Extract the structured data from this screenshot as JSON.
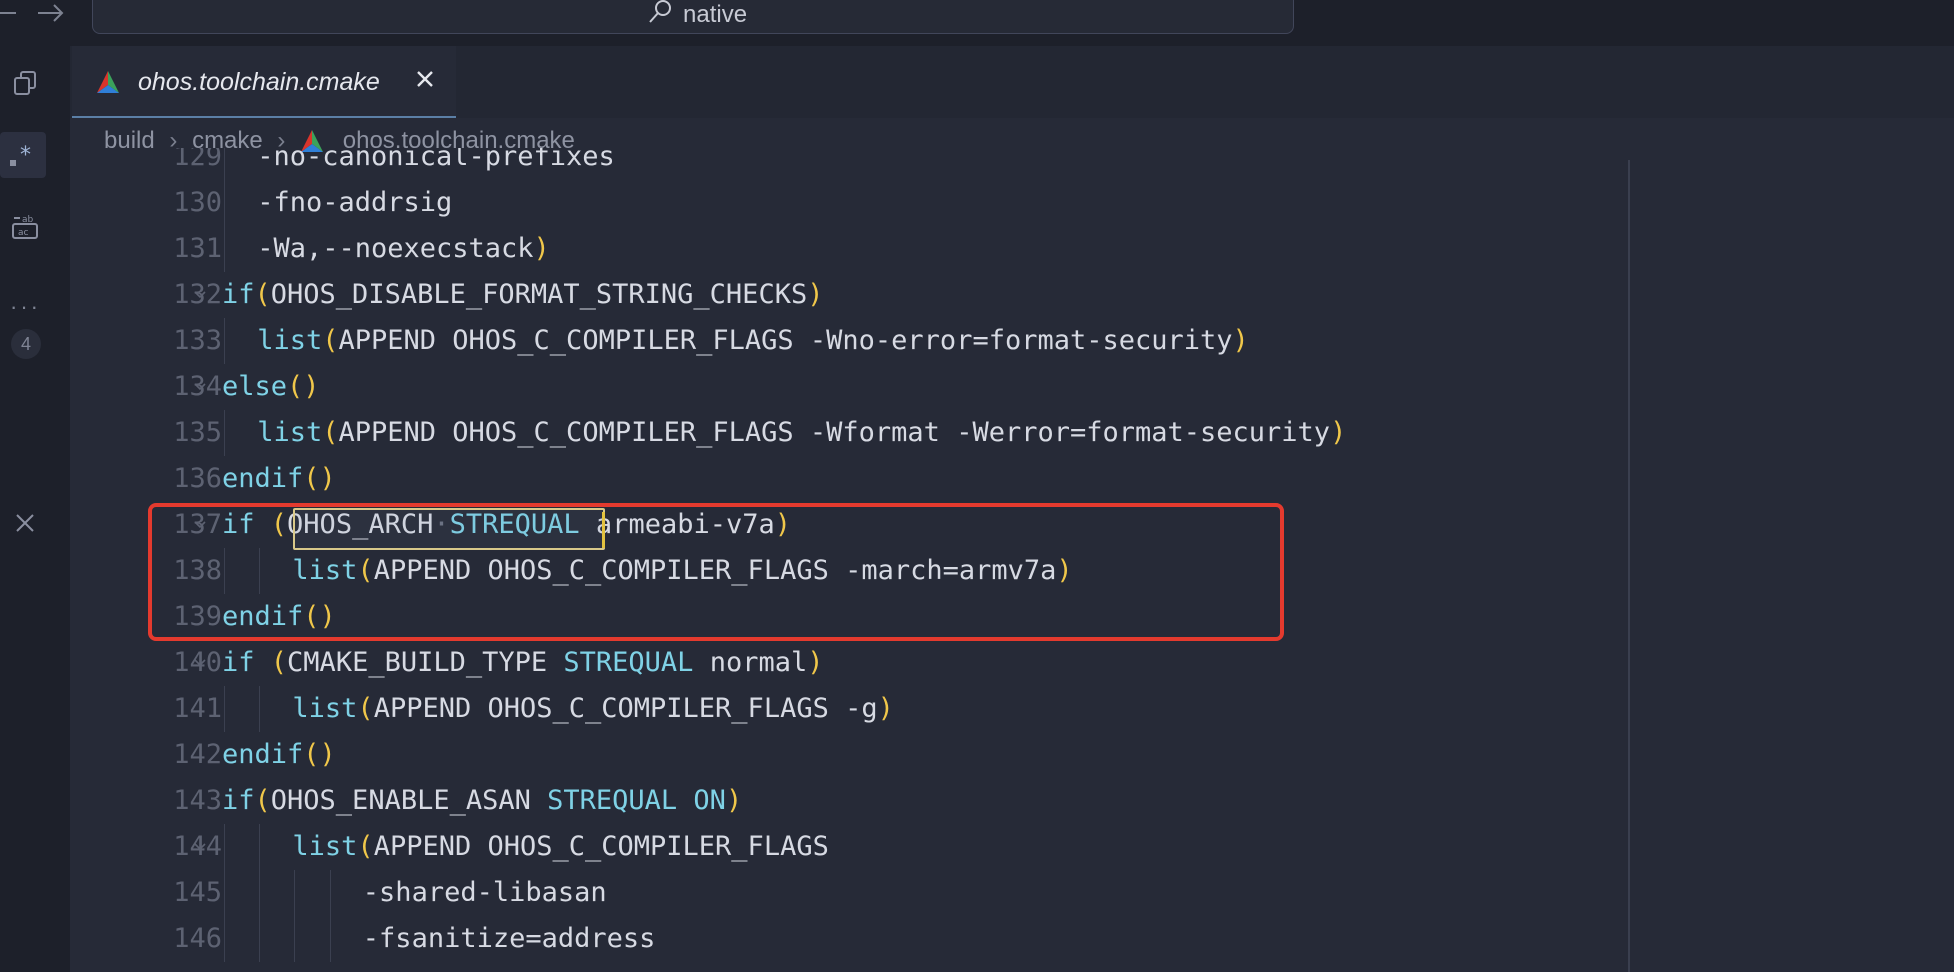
{
  "search": {
    "text": "native"
  },
  "activity": {
    "badge": "4"
  },
  "tab": {
    "label": "ohos.toolchain.cmake"
  },
  "breadcrumbs": [
    "build",
    "cmake",
    "ohos.toolchain.cmake"
  ],
  "code": {
    "lines": [
      {
        "n": "129",
        "indent": 1,
        "fold": false,
        "tokens": [
          {
            "t": "-no-canonical-prefixes",
            "c": "plain"
          }
        ]
      },
      {
        "n": "130",
        "indent": 1,
        "fold": false,
        "tokens": [
          {
            "t": "-fno-addrsig",
            "c": "plain"
          }
        ]
      },
      {
        "n": "131",
        "indent": 1,
        "fold": false,
        "tokens": [
          {
            "t": "-Wa,--noexecstack",
            "c": "plain"
          },
          {
            "t": ")",
            "c": "paren"
          }
        ]
      },
      {
        "n": "132",
        "indent": 0,
        "fold": true,
        "tokens": [
          {
            "t": "if",
            "c": "kw"
          },
          {
            "t": "(",
            "c": "paren"
          },
          {
            "t": "OHOS_DISABLE_FORMAT_STRING_CHECKS",
            "c": "plain"
          },
          {
            "t": ")",
            "c": "paren"
          }
        ]
      },
      {
        "n": "133",
        "indent": 1,
        "fold": false,
        "tokens": [
          {
            "t": "list",
            "c": "kw"
          },
          {
            "t": "(",
            "c": "paren"
          },
          {
            "t": "APPEND OHOS_C_COMPILER_FLAGS -Wno-error=format-security",
            "c": "plain"
          },
          {
            "t": ")",
            "c": "paren"
          }
        ]
      },
      {
        "n": "134",
        "indent": 0,
        "fold": true,
        "tokens": [
          {
            "t": "else",
            "c": "kw"
          },
          {
            "t": "()",
            "c": "paren"
          }
        ]
      },
      {
        "n": "135",
        "indent": 1,
        "fold": false,
        "tokens": [
          {
            "t": "list",
            "c": "kw"
          },
          {
            "t": "(",
            "c": "paren"
          },
          {
            "t": "APPEND OHOS_C_COMPILER_FLAGS -Wformat -Werror=format-security",
            "c": "plain"
          },
          {
            "t": ")",
            "c": "paren"
          }
        ]
      },
      {
        "n": "136",
        "indent": 0,
        "fold": false,
        "tokens": [
          {
            "t": "endif",
            "c": "kw"
          },
          {
            "t": "()",
            "c": "paren"
          }
        ]
      },
      {
        "n": "137",
        "indent": 0,
        "fold": true,
        "tokens": [
          {
            "t": "if",
            "c": "kw"
          },
          {
            "t": " ",
            "c": "plain"
          },
          {
            "t": "(",
            "c": "paren"
          },
          {
            "t": "OHOS_ARCH",
            "c": "plain"
          },
          {
            "t": "·",
            "c": "dot"
          },
          {
            "t": "STREQUAL",
            "c": "kw"
          },
          {
            "t": " armeabi-v7a",
            "c": "plain"
          },
          {
            "t": ")",
            "c": "paren"
          }
        ]
      },
      {
        "n": "138",
        "indent": 2,
        "fold": false,
        "tokens": [
          {
            "t": "list",
            "c": "kw"
          },
          {
            "t": "(",
            "c": "paren"
          },
          {
            "t": "APPEND OHOS_C_COMPILER_FLAGS -march=armv7a",
            "c": "plain"
          },
          {
            "t": ")",
            "c": "paren"
          }
        ]
      },
      {
        "n": "139",
        "indent": 0,
        "fold": false,
        "tokens": [
          {
            "t": "endif",
            "c": "kw"
          },
          {
            "t": "()",
            "c": "paren"
          }
        ]
      },
      {
        "n": "140",
        "indent": 0,
        "fold": true,
        "tokens": [
          {
            "t": "if",
            "c": "kw"
          },
          {
            "t": " ",
            "c": "plain"
          },
          {
            "t": "(",
            "c": "paren"
          },
          {
            "t": "CMAKE_BUILD_TYPE ",
            "c": "plain"
          },
          {
            "t": "STREQUAL",
            "c": "kw"
          },
          {
            "t": " normal",
            "c": "plain"
          },
          {
            "t": ")",
            "c": "paren"
          }
        ]
      },
      {
        "n": "141",
        "indent": 2,
        "fold": false,
        "tokens": [
          {
            "t": "list",
            "c": "kw"
          },
          {
            "t": "(",
            "c": "paren"
          },
          {
            "t": "APPEND OHOS_C_COMPILER_FLAGS -g",
            "c": "plain"
          },
          {
            "t": ")",
            "c": "paren"
          }
        ]
      },
      {
        "n": "142",
        "indent": 0,
        "fold": false,
        "tokens": [
          {
            "t": "endif",
            "c": "kw"
          },
          {
            "t": "()",
            "c": "paren"
          }
        ]
      },
      {
        "n": "143",
        "indent": 0,
        "fold": false,
        "tokens": [
          {
            "t": "if",
            "c": "kw"
          },
          {
            "t": "(",
            "c": "paren"
          },
          {
            "t": "OHOS_ENABLE_ASAN ",
            "c": "plain"
          },
          {
            "t": "STREQUAL ON",
            "c": "kw"
          },
          {
            "t": ")",
            "c": "paren"
          }
        ]
      },
      {
        "n": "144",
        "indent": 2,
        "fold": true,
        "tokens": [
          {
            "t": "list",
            "c": "kw"
          },
          {
            "t": "(",
            "c": "paren"
          },
          {
            "t": "APPEND OHOS_C_COMPILER_FLAGS",
            "c": "plain"
          }
        ]
      },
      {
        "n": "145",
        "indent": 4,
        "fold": false,
        "tokens": [
          {
            "t": "-shared-libasan",
            "c": "plain"
          }
        ]
      },
      {
        "n": "146",
        "indent": 4,
        "fold": false,
        "tokens": [
          {
            "t": "-fsanitize=address",
            "c": "plain"
          }
        ]
      }
    ]
  },
  "colors": {
    "keyword": "#7fd2e6",
    "paren": "#f0c74a",
    "text": "#d7dae3",
    "annotation": "#e43a2e"
  }
}
